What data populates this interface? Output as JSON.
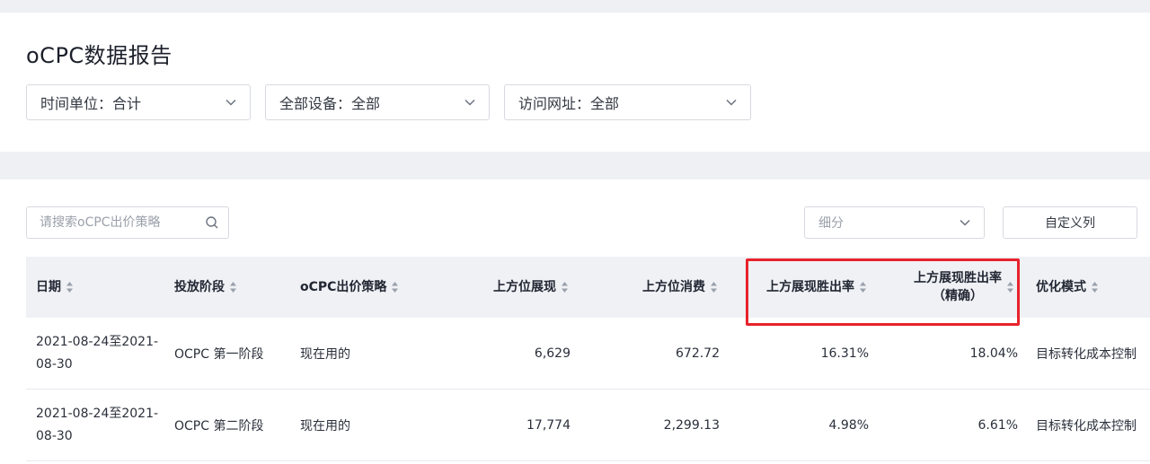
{
  "header": {
    "title": "oCPC数据报告"
  },
  "filters": [
    {
      "label": "时间单位：合计"
    },
    {
      "label": "全部设备：全部"
    },
    {
      "label": "访问网址：全部"
    }
  ],
  "toolbar": {
    "search_placeholder": "请搜索oCPC出价策略",
    "segment_placeholder": "细分",
    "custom_columns_label": "自定义列"
  },
  "table": {
    "columns": [
      {
        "label": "日期"
      },
      {
        "label": "投放阶段"
      },
      {
        "label": "oCPC出价策略"
      },
      {
        "label": "上方位展现"
      },
      {
        "label": "上方位消费"
      },
      {
        "label": "上方展现胜出率"
      },
      {
        "label_line1": "上方展现胜出率",
        "label_line2": "（精确）"
      },
      {
        "label": "优化模式"
      }
    ],
    "rows": [
      {
        "date": "2021-08-24至2021-08-30",
        "stage": "OCPC 第一阶段",
        "strategy": "现在用的",
        "top_impressions": "6,629",
        "top_cost": "672.72",
        "top_win_rate": "16.31%",
        "top_win_rate_exact": "18.04%",
        "mode": "目标转化成本控制"
      },
      {
        "date": "2021-08-24至2021-08-30",
        "stage": "OCPC 第二阶段",
        "strategy": "现在用的",
        "top_impressions": "17,774",
        "top_cost": "2,299.13",
        "top_win_rate": "4.98%",
        "top_win_rate_exact": "6.61%",
        "mode": "目标转化成本控制"
      }
    ]
  },
  "colors": {
    "highlight": "#e8222b",
    "header_bg": "#eff1f5",
    "page_bg": "#eef0f4"
  },
  "icons": {
    "filter_dropdown": "chevron-down-icon",
    "search": "search-icon",
    "sort": "sort-icon"
  }
}
